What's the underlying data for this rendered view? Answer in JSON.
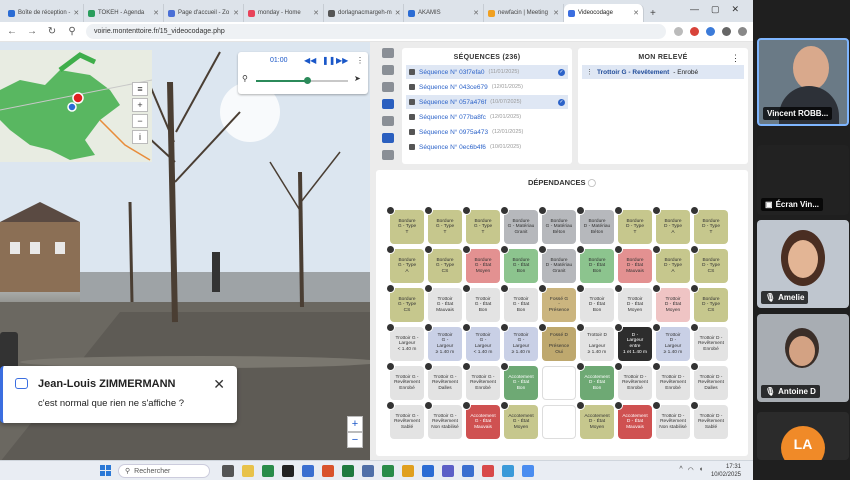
{
  "browser": {
    "tabs": [
      {
        "label": "Boîte de réception -",
        "color": "#2b6cd4"
      },
      {
        "label": "TOKEH - Agenda",
        "color": "#2a9d5c"
      },
      {
        "label": "Page d'accueil - Zo",
        "color": "#4a6fd6"
      },
      {
        "label": "monday - Home",
        "color": "#e8435a"
      },
      {
        "label": "dorlagnacmargeh-m",
        "color": "#555555"
      },
      {
        "label": "AKAMIS",
        "color": "#2b6cd4"
      },
      {
        "label": "newfacin | Meeting",
        "color": "#f0a020"
      },
      {
        "label": "Videocodage",
        "color": "#3b6ee0"
      }
    ],
    "url": "voirie.montenttoire.fr/15_videocodage.php"
  },
  "player": {
    "time": "01:00",
    "progress": 0.55
  },
  "sequences": {
    "title": "SÉQUENCES (236)",
    "items": [
      {
        "label": "Séquence N° 03f7efa0",
        "date": "(11/01/2025)",
        "selected": true,
        "checked": true
      },
      {
        "label": "Séquence N° 043ce679",
        "date": "(12/01/2025)",
        "selected": false,
        "checked": false
      },
      {
        "label": "Séquence N° 057a476f",
        "date": "(10/07/2025)",
        "selected": true,
        "checked": true
      },
      {
        "label": "Séquence N° 077ba8fc",
        "date": "(12/01/2025)",
        "selected": false,
        "checked": false
      },
      {
        "label": "Séquence N° 0975a473",
        "date": "(12/01/2025)",
        "selected": false,
        "checked": false
      },
      {
        "label": "Séquence N° 0ec6b4f6",
        "date": "(10/01/2025)",
        "selected": false,
        "checked": false
      }
    ]
  },
  "releve": {
    "title": "MON RELEVÉ",
    "item_name": "Trottoir G - Revêtement",
    "item_value": "- Enrobé"
  },
  "dependances": {
    "title": "DÉPENDANCES",
    "cells": [
      {
        "t": "Bordure\nG - Type\nT",
        "c": "c-olive"
      },
      {
        "t": "Bordure\nG - Type\nT",
        "c": "c-olive"
      },
      {
        "t": "Bordure\nG - Type\nT",
        "c": "c-olive"
      },
      {
        "t": "Bordure\nG - Matériau\nGranit",
        "c": "c-grey"
      },
      {
        "t": "Bordure\nG - Matériau\nBéton",
        "c": "c-grey"
      },
      {
        "t": "Bordure\nD - Matériau\nBéton",
        "c": "c-grey"
      },
      {
        "t": "Bordure\nD - Type\nT",
        "c": "c-olive"
      },
      {
        "t": "Bordure\nD - Type\nA",
        "c": "c-olive"
      },
      {
        "t": "Bordure\nD - Type\nT",
        "c": "c-olive"
      },
      {
        "t": "Bordure\nG - Type\nA",
        "c": "c-olive"
      },
      {
        "t": "Bordure\nG - Type\nCS",
        "c": "c-olive"
      },
      {
        "t": "Bordure\nG - État\nMoyen",
        "c": "c-red"
      },
      {
        "t": "Bordure\nG - État\nBon",
        "c": "c-green"
      },
      {
        "t": "Bordure\nD - Matériau\nGranit",
        "c": "c-grey"
      },
      {
        "t": "Bordure\nD - État\nBon",
        "c": "c-green"
      },
      {
        "t": "Bordure\nD - État\nMauvais",
        "c": "c-red"
      },
      {
        "t": "Bordure\nD - Type\nA",
        "c": "c-olive"
      },
      {
        "t": "Bordure\nD - Type\nCS",
        "c": "c-olive"
      },
      {
        "t": "Bordure\nG - Type\nCS",
        "c": "c-olive"
      },
      {
        "t": "Trottoir\nG - État\nMauvais",
        "c": "c-pale"
      },
      {
        "t": "Trottoir\nG - État\nBon",
        "c": "c-pale"
      },
      {
        "t": "Trottoir\nG - État\nBon",
        "c": "c-pale"
      },
      {
        "t": "Fossé G\n-\nPrésence",
        "c": "c-gold"
      },
      {
        "t": "Trottoir\nD - État\nBon",
        "c": "c-pale"
      },
      {
        "t": "Trottoir\nD - État\nMoyen",
        "c": "c-pale"
      },
      {
        "t": "Trottoir\nD - État\nMoyen",
        "c": "c-pink"
      },
      {
        "t": "Bordure\nD - Type\nCS",
        "c": "c-olive"
      },
      {
        "t": "Trottoir G -\nLargeur\n< 1.40 m",
        "c": "c-pale"
      },
      {
        "t": "Trottoir\nG -\nLargeur\n≥ 1.40 m",
        "c": "c-lav"
      },
      {
        "t": "Trottoir\nG -\nLargeur\n< 1.40 m",
        "c": "c-lav"
      },
      {
        "t": "Trottoir\nG -\nLargeur\n≥ 1.40 m",
        "c": "c-lav"
      },
      {
        "t": "Fossé D\n-\nPrésence\nOui",
        "c": "c-tan"
      },
      {
        "t": "Trottoir D\n-\nLargeur\n≥ 1.40 m",
        "c": "c-pale"
      },
      {
        "t": "D -\nLargeur\nentre\n1 et 1.40 m",
        "c": "c-black"
      },
      {
        "t": "Trottoir\nD -\nLargeur\n≥ 1.40 m",
        "c": "c-lav"
      },
      {
        "t": "Trottoir D -\nRevêtement\nEnrobé",
        "c": "c-pale"
      },
      {
        "t": "Trottoir G -\nRevêtement\nEnrobé",
        "c": "c-pale"
      },
      {
        "t": "Trottoir G -\nRevêtement\nDalles",
        "c": "c-pale"
      },
      {
        "t": "Trottoir G -\nRevêtement\nEnrobé",
        "c": "c-pale"
      },
      {
        "t": "Accotement\nG - État\nBon",
        "c": "c-dgreen"
      },
      {
        "t": "",
        "c": "empty"
      },
      {
        "t": "Accotement\nD - État\nBon",
        "c": "c-dgreen"
      },
      {
        "t": "Trottoir D -\nRevêtement\nEnrobé",
        "c": "c-pale"
      },
      {
        "t": "Trottoir D -\nRevêtement\nEnrobé",
        "c": "c-pale"
      },
      {
        "t": "Trottoir D -\nRevêtement\nDalles",
        "c": "c-pale"
      },
      {
        "t": "Trottoir G -\nRevêtement\nSablé",
        "c": "c-pale"
      },
      {
        "t": "Trottoir G -\nRevêtement\nNon stabilisé",
        "c": "c-pale"
      },
      {
        "t": "Accotement\nG - État\nMauvais",
        "c": "c-dred"
      },
      {
        "t": "Accotement\nG - État\nMoyen",
        "c": "c-olive"
      },
      {
        "t": "",
        "c": "empty"
      },
      {
        "t": "Accotement\nD - État\nMoyen",
        "c": "c-olive"
      },
      {
        "t": "Accotement\nD - État\nMauvais",
        "c": "c-dred"
      },
      {
        "t": "Trottoir D -\nRevêtement\nNon stabilisé",
        "c": "c-pale"
      },
      {
        "t": "Trottoir D -\nRevêtement\nSablé",
        "c": "c-pale"
      }
    ]
  },
  "chat": {
    "name": "Jean-Louis ZIMMERMANN",
    "message": "c'est normal que rien ne s'affiche ?"
  },
  "participants": [
    {
      "name": "Vincent ROBB..."
    },
    {
      "name": "Écran Vin..."
    },
    {
      "name": "Amelie"
    },
    {
      "name": "Antoine D"
    },
    {
      "name": "LA"
    }
  ],
  "taskbar": {
    "search_placeholder": "Rechercher",
    "time": "17:31",
    "date": "10/02/2025"
  }
}
